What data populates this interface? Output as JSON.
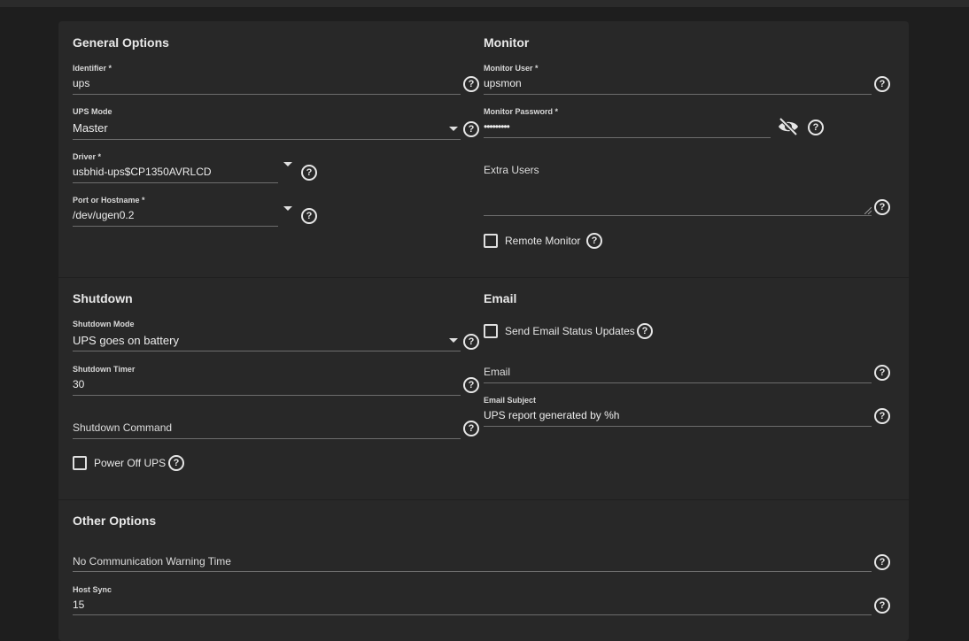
{
  "general": {
    "title": "General Options",
    "identifier": {
      "label": "Identifier *",
      "value": "ups"
    },
    "ups_mode": {
      "label": "UPS Mode",
      "value": "Master"
    },
    "driver": {
      "label": "Driver *",
      "value": "usbhid-ups$CP1350AVRLCD"
    },
    "port": {
      "label": "Port or Hostname *",
      "value": "/dev/ugen0.2"
    }
  },
  "monitor": {
    "title": "Monitor",
    "user": {
      "label": "Monitor User *",
      "value": "upsmon"
    },
    "password": {
      "label": "Monitor Password *",
      "value": "•••••••••"
    },
    "extra_users": {
      "label": "Extra Users",
      "value": ""
    },
    "remote_monitor": {
      "label": "Remote Monitor",
      "checked": false
    }
  },
  "shutdown": {
    "title": "Shutdown",
    "mode": {
      "label": "Shutdown Mode",
      "value": "UPS goes on battery"
    },
    "timer": {
      "label": "Shutdown Timer",
      "value": "30"
    },
    "command": {
      "label": "Shutdown Command",
      "value": ""
    },
    "power_off": {
      "label": "Power Off UPS",
      "checked": false
    }
  },
  "email": {
    "title": "Email",
    "send_updates": {
      "label": "Send Email Status Updates",
      "checked": false
    },
    "email": {
      "label": "Email",
      "value": ""
    },
    "subject": {
      "label": "Email Subject",
      "value": "UPS report generated by %h"
    }
  },
  "other": {
    "title": "Other Options",
    "no_comm_warning": {
      "label": "No Communication Warning Time",
      "value": ""
    },
    "host_sync": {
      "label": "Host Sync",
      "value": "15"
    }
  },
  "help_symbol": "?",
  "colors": {
    "background": "#1e1e1e",
    "card": "#282828",
    "text": "#e6e6e6",
    "underline": "#6d6d6d"
  }
}
